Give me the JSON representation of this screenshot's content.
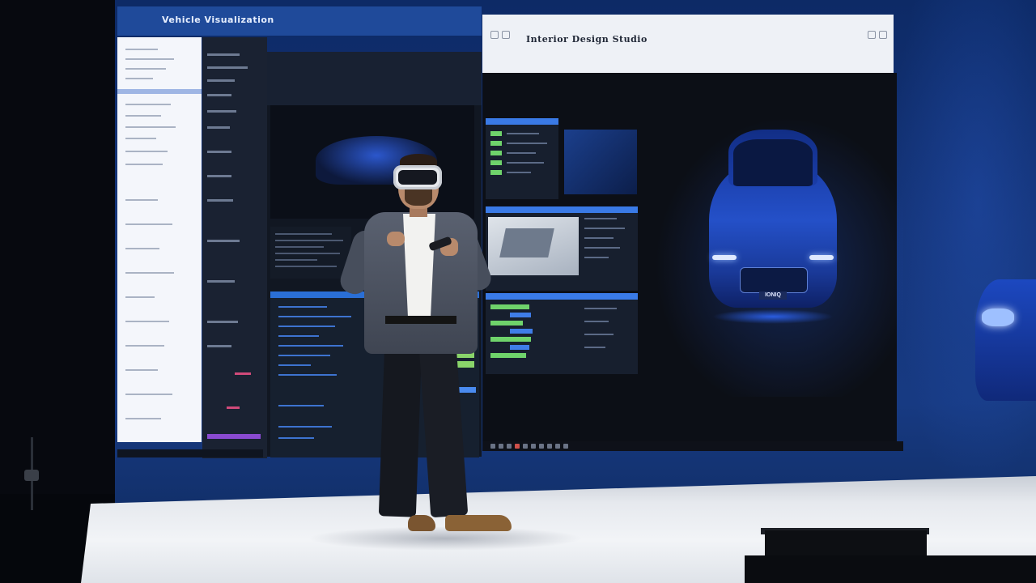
{
  "screen": {
    "left_window_title": "Vehicle Visualization",
    "right_window_title": "Interior Design Studio",
    "car_plate": "IONIQ"
  },
  "colors": {
    "led_wall": "#173a82",
    "ui_accent_blue": "#2a6fd6",
    "ui_green": "#6fd36b",
    "car_body": "#2450c8",
    "stage_floor": "#eef1f5"
  },
  "icons": [
    "vr-headset-icon",
    "controller-icon"
  ]
}
